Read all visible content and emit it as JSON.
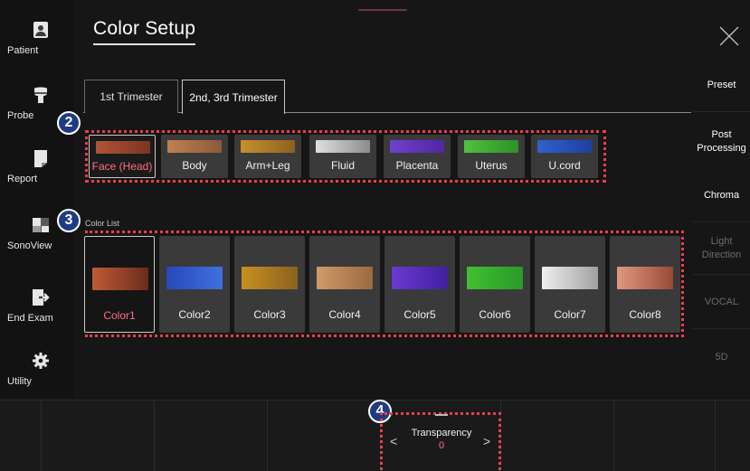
{
  "sidebar": {
    "items": [
      {
        "label": "Patient",
        "icon": "patient-icon"
      },
      {
        "label": "Probe",
        "icon": "probe-icon"
      },
      {
        "label": "Report",
        "icon": "report-icon"
      },
      {
        "label": "SonoView",
        "icon": "sonoview-icon"
      },
      {
        "label": "End Exam",
        "icon": "end-exam-icon"
      },
      {
        "label": "Utility",
        "icon": "utility-gear-icon"
      }
    ]
  },
  "header": {
    "title": "Color Setup",
    "close_icon": "close-icon"
  },
  "tabs": [
    {
      "label": "1st Trimester",
      "active": false
    },
    {
      "label": "2nd, 3rd Trimester",
      "active": true
    }
  ],
  "badges": [
    "2",
    "3",
    "4"
  ],
  "body_parts": [
    {
      "label": "Face (Head)",
      "selected": true,
      "swatch": [
        "#b05535",
        "#7a3522"
      ]
    },
    {
      "label": "Body",
      "selected": false,
      "swatch": [
        "#c08050",
        "#8a5a3a"
      ]
    },
    {
      "label": "Arm+Leg",
      "selected": false,
      "swatch": [
        "#c8902c",
        "#8a6220"
      ]
    },
    {
      "label": "Fluid",
      "selected": false,
      "swatch": [
        "#e0e0e0",
        "#8c8c8c"
      ]
    },
    {
      "label": "Placenta",
      "selected": false,
      "swatch": [
        "#7040d0",
        "#5028a0"
      ]
    },
    {
      "label": "Uterus",
      "selected": false,
      "swatch": [
        "#50c040",
        "#309028"
      ]
    },
    {
      "label": "U.cord",
      "selected": false,
      "swatch": [
        "#3060d0",
        "#2040a0"
      ]
    }
  ],
  "color_list": {
    "label": "Color List",
    "items": [
      {
        "label": "Color1",
        "selected": true,
        "swatch": [
          "#c05a38",
          "#6a2c1c"
        ]
      },
      {
        "label": "Color2",
        "selected": false,
        "swatch": [
          "#2848b8",
          "#4070e0"
        ]
      },
      {
        "label": "Color3",
        "selected": false,
        "swatch": [
          "#c89020",
          "#8a6220"
        ]
      },
      {
        "label": "Color4",
        "selected": false,
        "swatch": [
          "#d09a68",
          "#9a6a40"
        ]
      },
      {
        "label": "Color5",
        "selected": false,
        "swatch": [
          "#6a3ad0",
          "#4020a0"
        ]
      },
      {
        "label": "Color6",
        "selected": false,
        "swatch": [
          "#40c030",
          "#2a9a28"
        ]
      },
      {
        "label": "Color7",
        "selected": false,
        "swatch": [
          "#f0f0f0",
          "#a0a0a0"
        ]
      },
      {
        "label": "Color8",
        "selected": false,
        "swatch": [
          "#e09880",
          "#9a4a38"
        ]
      }
    ]
  },
  "right_panel": [
    {
      "label": "Preset",
      "enabled": true
    },
    {
      "label": "Post Processing",
      "enabled": true
    },
    {
      "label": "Chroma",
      "enabled": true
    },
    {
      "label": "Light Direction",
      "enabled": false
    },
    {
      "label": "VOCAL",
      "enabled": false
    },
    {
      "label": "5D",
      "enabled": false
    }
  ],
  "transparency": {
    "label": "Transparency",
    "value": "0",
    "prev": "<",
    "next": ">"
  },
  "colors": {
    "accent": "#ff6f7e",
    "highlight_dots": "#e8404a",
    "badge": "#1e3c82"
  }
}
